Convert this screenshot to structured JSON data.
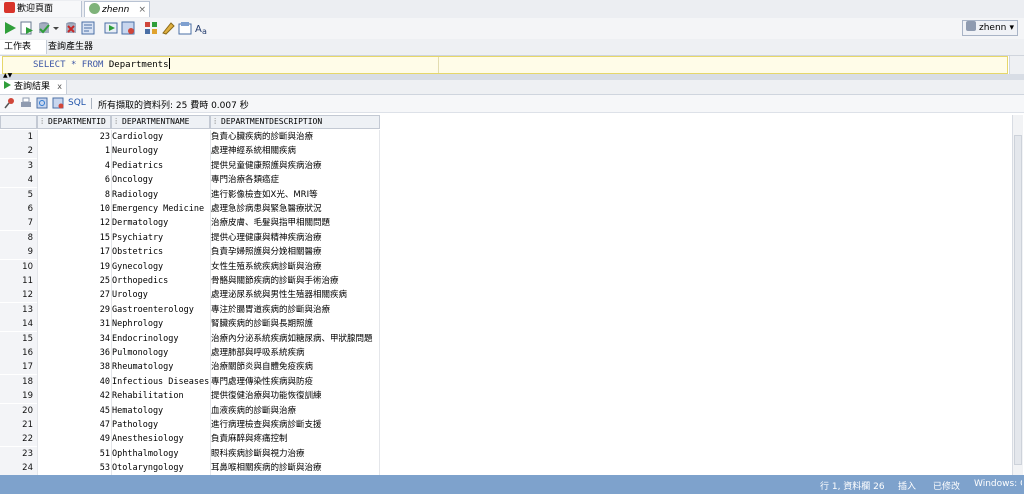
{
  "doc_tabs": [
    {
      "label": "歡迎頁面",
      "icon": "oracle-logo-icon"
    },
    {
      "label": "zhenn",
      "icon": "database-connection-icon"
    }
  ],
  "toolbar": {
    "icons": [
      "run-statement-icon",
      "run-script-icon",
      "commit-icon",
      "dropdown-arrow-icon",
      "rollback-icon",
      "explain-plan-icon",
      "autotrace-icon",
      "sql-tuning-icon",
      "clear-icon",
      "format-icon",
      "history-icon",
      "uppercase-icon"
    ],
    "user": "zhenn"
  },
  "worksheet_tabs": [
    "工作表",
    "查詢產生器"
  ],
  "editor": {
    "sql_select": "SELECT",
    "sql_star": "*",
    "sql_from": "FROM",
    "sql_table": "Departments"
  },
  "result_tab": {
    "label": "查詢結果",
    "close": "x"
  },
  "result_toolbar": {
    "sql_label": "SQL",
    "fetch_status": "所有擷取的資料列: 25 費時 0.007 秒"
  },
  "grid": {
    "columns": [
      "DEPARTMENTID",
      "DEPARTMENTNAME",
      "DEPARTMENTDESCRIPTION"
    ],
    "rows": [
      {
        "n": "1",
        "id": "23",
        "name": "Cardiology",
        "desc": "負責心臟疾病的診斷與治療"
      },
      {
        "n": "2",
        "id": "1",
        "name": "Neurology",
        "desc": "處理神經系統相關疾病"
      },
      {
        "n": "3",
        "id": "4",
        "name": "Pediatrics",
        "desc": "提供兒童健康照護與疾病治療"
      },
      {
        "n": "4",
        "id": "6",
        "name": "Oncology",
        "desc": "專門治療各類癌症"
      },
      {
        "n": "5",
        "id": "8",
        "name": "Radiology",
        "desc": "進行影像檢查如X光、MRI等"
      },
      {
        "n": "6",
        "id": "10",
        "name": "Emergency Medicine",
        "desc": "處理急診病患與緊急醫療狀況"
      },
      {
        "n": "7",
        "id": "12",
        "name": "Dermatology",
        "desc": "治療皮膚、毛髮與指甲相關問題"
      },
      {
        "n": "8",
        "id": "15",
        "name": "Psychiatry",
        "desc": "提供心理健康與精神疾病治療"
      },
      {
        "n": "9",
        "id": "17",
        "name": "Obstetrics",
        "desc": "負責孕婦照護與分娩相關醫療"
      },
      {
        "n": "10",
        "id": "19",
        "name": "Gynecology",
        "desc": "女性生殖系統疾病診斷與治療"
      },
      {
        "n": "11",
        "id": "25",
        "name": "Orthopedics",
        "desc": "骨骼與關節疾病的診斷與手術治療"
      },
      {
        "n": "12",
        "id": "27",
        "name": "Urology",
        "desc": "處理泌尿系統與男性生殖器相關疾病"
      },
      {
        "n": "13",
        "id": "29",
        "name": "Gastroenterology",
        "desc": "專注於腸胃道疾病的診斷與治療"
      },
      {
        "n": "14",
        "id": "31",
        "name": "Nephrology",
        "desc": "腎臟疾病的診斷與長期照護"
      },
      {
        "n": "15",
        "id": "34",
        "name": "Endocrinology",
        "desc": "治療內分泌系統疾病如糖尿病、甲狀腺問題"
      },
      {
        "n": "16",
        "id": "36",
        "name": "Pulmonology",
        "desc": "處理肺部與呼吸系統疾病"
      },
      {
        "n": "17",
        "id": "38",
        "name": "Rheumatology",
        "desc": "治療關節炎與自體免疫疾病"
      },
      {
        "n": "18",
        "id": "40",
        "name": "Infectious Diseases",
        "desc": "專門處理傳染性疾病與防疫"
      },
      {
        "n": "19",
        "id": "42",
        "name": "Rehabilitation",
        "desc": "提供復健治療與功能恢復訓練"
      },
      {
        "n": "20",
        "id": "45",
        "name": "Hematology",
        "desc": "血液疾病的診斷與治療"
      },
      {
        "n": "21",
        "id": "47",
        "name": "Pathology",
        "desc": "進行病理檢查與疾病診斷支援"
      },
      {
        "n": "22",
        "id": "49",
        "name": "Anesthesiology",
        "desc": "負責麻醉與疼痛控制"
      },
      {
        "n": "23",
        "id": "51",
        "name": "Ophthalmology",
        "desc": "眼科疾病診斷與視力治療"
      },
      {
        "n": "24",
        "id": "53",
        "name": "Otolaryngology",
        "desc": "耳鼻喉相關疾病的診斷與治療"
      }
    ]
  },
  "status_bar": {
    "position": "行 1, 資料欄 26",
    "mode": "插入",
    "modified": "已修改",
    "line_ending": "Windows: CF"
  }
}
